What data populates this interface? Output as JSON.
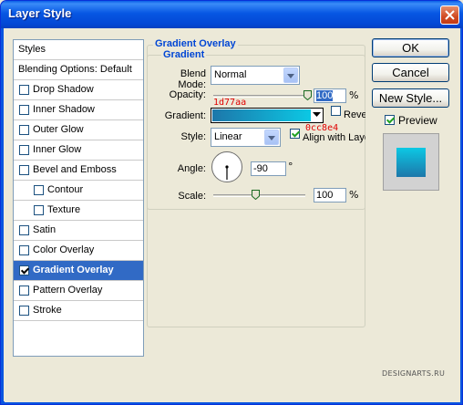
{
  "window": {
    "title": "Layer Style"
  },
  "styles_list": {
    "header": "Styles",
    "blending_options": "Blending Options: Default",
    "items": [
      {
        "label": "Drop Shadow",
        "checked": false
      },
      {
        "label": "Inner Shadow",
        "checked": false
      },
      {
        "label": "Outer Glow",
        "checked": false
      },
      {
        "label": "Inner Glow",
        "checked": false
      },
      {
        "label": "Bevel and Emboss",
        "checked": false
      },
      {
        "label": "Contour",
        "checked": false
      },
      {
        "label": "Texture",
        "checked": false
      },
      {
        "label": "Satin",
        "checked": false
      },
      {
        "label": "Color Overlay",
        "checked": false
      },
      {
        "label": "Gradient Overlay",
        "checked": true,
        "selected": true
      },
      {
        "label": "Pattern Overlay",
        "checked": false
      },
      {
        "label": "Stroke",
        "checked": false
      }
    ]
  },
  "panel": {
    "group_title": "Gradient Overlay",
    "subgroup_title": "Gradient",
    "blend_mode_label": "Blend Mode:",
    "blend_mode_value": "Normal",
    "opacity_label": "Opacity:",
    "opacity_value": "100",
    "opacity_unit": "%",
    "opacity_slider": 1.0,
    "gradient_label": "Gradient:",
    "reverse_label": "Reverse",
    "style_label": "Style:",
    "style_value": "Linear",
    "align_label": "Align with Layer",
    "angle_label": "Angle:",
    "angle_value": "-90",
    "angle_unit": "°",
    "scale_label": "Scale:",
    "scale_value": "100",
    "scale_unit": "%",
    "scale_slider": 0.46
  },
  "annotations": {
    "color_start": "1d77aa",
    "color_end": "0cc8e4"
  },
  "colors": {
    "gradient_start": "#1d77aa",
    "gradient_end": "#0cc8e4",
    "selection": "#316ac5",
    "group_title": "#0046d5"
  },
  "buttons": {
    "ok": "OK",
    "cancel": "Cancel",
    "new_style": "New Style...",
    "preview": "Preview"
  },
  "watermark": "DESIGNARTS.RU"
}
